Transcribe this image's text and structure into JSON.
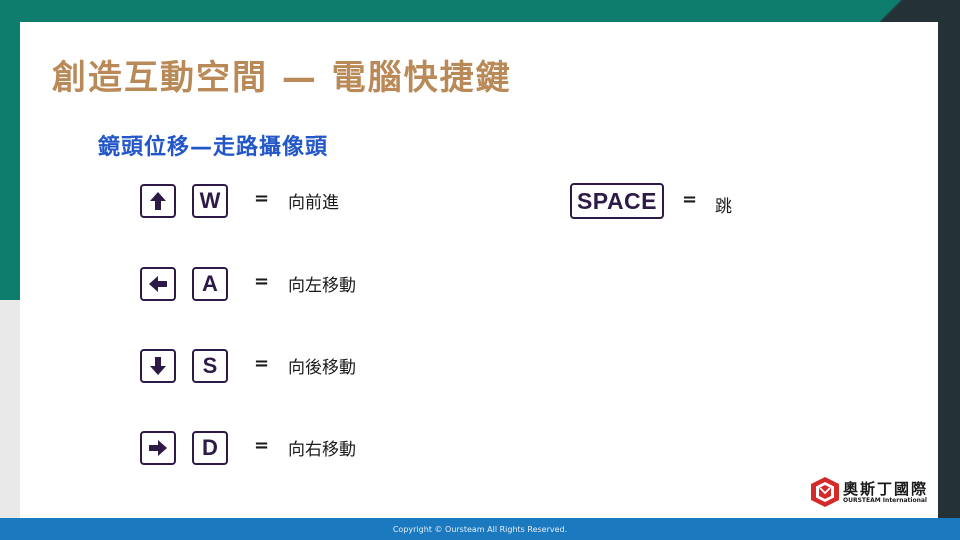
{
  "slide": {
    "title": "創造互動空間 — 電腦快捷鍵",
    "subtitle": "鏡頭位移—走路攝像頭"
  },
  "shortcuts": [
    {
      "arrow": "up-arrow-icon",
      "key": "W",
      "equals": "=",
      "action": "向前進"
    },
    {
      "arrow": "left-arrow-icon",
      "key": "A",
      "equals": "=",
      "action": "向左移動"
    },
    {
      "arrow": "down-arrow-icon",
      "key": "S",
      "equals": "=",
      "action": "向後移動"
    },
    {
      "arrow": "right-arrow-icon",
      "key": "D",
      "equals": "=",
      "action": "向右移動"
    }
  ],
  "jump": {
    "key": "SPACE",
    "equals": "=",
    "action": "跳"
  },
  "logo": {
    "name_cn": "奧斯丁國際",
    "name_en": "OURSTEAM International"
  },
  "footer": {
    "copyright": "Copyright © Oursteam All Rights Reserved."
  },
  "colors": {
    "title": "#b98a57",
    "subtitle": "#2357c8",
    "key_border": "#2e1a47",
    "footer": "#1b79c0",
    "teal": "#0f7d6e"
  }
}
